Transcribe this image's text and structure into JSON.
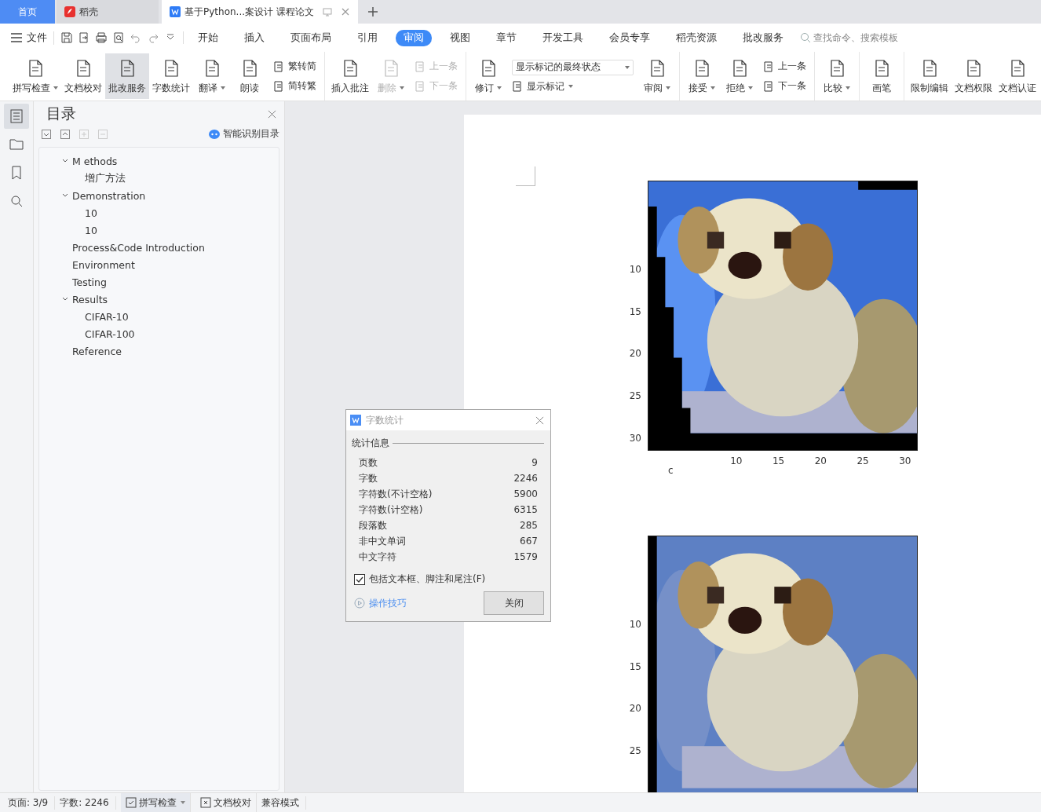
{
  "tabs": [
    {
      "kind": "home",
      "label": "首页",
      "selected": false
    },
    {
      "kind": "app",
      "label": "稻壳",
      "selected": false
    },
    {
      "kind": "doc",
      "label": "基于Python...案设计 课程论文",
      "selected": true
    }
  ],
  "menu": {
    "file": "文件",
    "ribbon_tabs": [
      {
        "label": "开始",
        "selected": false
      },
      {
        "label": "插入",
        "selected": false
      },
      {
        "label": "页面布局",
        "selected": false
      },
      {
        "label": "引用",
        "selected": false
      },
      {
        "label": "审阅",
        "selected": true
      },
      {
        "label": "视图",
        "selected": false
      },
      {
        "label": "章节",
        "selected": false
      },
      {
        "label": "开发工具",
        "selected": false
      },
      {
        "label": "会员专享",
        "selected": false
      },
      {
        "label": "稻壳资源",
        "selected": false
      },
      {
        "label": "批改服务",
        "selected": false
      }
    ],
    "search": {
      "placeholder": "查找命令、搜索模板"
    }
  },
  "ribbon": [
    [
      {
        "kind": "big",
        "label": "拼写检查",
        "dropdown": true,
        "disabled": false,
        "selected": false
      },
      {
        "kind": "big",
        "label": "文档校对",
        "dropdown": false,
        "disabled": false,
        "selected": false
      },
      {
        "kind": "big",
        "label": "批改服务",
        "dropdown": false,
        "disabled": false,
        "selected": true
      },
      {
        "kind": "big",
        "label": "字数统计",
        "dropdown": false,
        "disabled": false,
        "selected": false
      },
      {
        "kind": "big",
        "label": "翻译",
        "dropdown": true,
        "disabled": false,
        "selected": false
      },
      {
        "kind": "big",
        "label": "朗读",
        "dropdown": false,
        "disabled": false,
        "selected": false
      },
      {
        "kind": "stack",
        "items": [
          {
            "label": "繁转简",
            "disabled": false
          },
          {
            "label": "简转繁",
            "disabled": false
          }
        ]
      }
    ],
    [
      {
        "kind": "big",
        "label": "插入批注",
        "dropdown": false,
        "disabled": false,
        "selected": false
      },
      {
        "kind": "big",
        "label": "删除",
        "dropdown": true,
        "disabled": true,
        "selected": false
      },
      {
        "kind": "stack",
        "items": [
          {
            "label": "上一条",
            "disabled": true
          },
          {
            "label": "下一条",
            "disabled": true
          }
        ]
      }
    ],
    [
      {
        "kind": "big",
        "label": "修订",
        "dropdown": true,
        "disabled": false,
        "selected": false
      },
      {
        "kind": "combo",
        "value": "显示标记的最终状态",
        "label": "显示标记"
      },
      {
        "kind": "big",
        "label": "审阅",
        "dropdown": true,
        "disabled": false,
        "selected": false
      }
    ],
    [
      {
        "kind": "big",
        "label": "接受",
        "dropdown": true,
        "disabled": false,
        "selected": false
      },
      {
        "kind": "big",
        "label": "拒绝",
        "dropdown": true,
        "disabled": false,
        "selected": false
      },
      {
        "kind": "stack",
        "items": [
          {
            "label": "上一条",
            "disabled": false
          },
          {
            "label": "下一条",
            "disabled": false
          }
        ]
      }
    ],
    [
      {
        "kind": "big",
        "label": "比较",
        "dropdown": true,
        "disabled": false,
        "selected": false
      }
    ],
    [
      {
        "kind": "big",
        "label": "画笔",
        "dropdown": false,
        "disabled": false,
        "selected": false
      }
    ],
    [
      {
        "kind": "big",
        "label": "限制编辑",
        "dropdown": false,
        "disabled": false,
        "selected": false
      },
      {
        "kind": "big",
        "label": "文档权限",
        "dropdown": false,
        "disabled": false,
        "selected": false
      },
      {
        "kind": "big",
        "label": "文档认证",
        "dropdown": false,
        "disabled": false,
        "selected": false
      }
    ]
  ],
  "toc": {
    "title": "目录",
    "smart": "智能识别目录",
    "items": [
      {
        "label": "M ethods",
        "expanded": true,
        "children": [
          {
            "label": "增广方法"
          }
        ]
      },
      {
        "label": "Demonstration",
        "expanded": true,
        "children": [
          {
            "label": "10"
          },
          {
            "label": "10"
          }
        ]
      },
      {
        "label": "Process&Code Introduction"
      },
      {
        "label": "Environment"
      },
      {
        "label": "Testing"
      },
      {
        "label": "Results",
        "expanded": true,
        "children": [
          {
            "label": "CIFAR-10"
          },
          {
            "label": "CIFAR-100"
          }
        ]
      },
      {
        "label": "Reference"
      }
    ]
  },
  "figures": [
    {
      "kind": "picture",
      "yticks": [
        "10",
        "15",
        "20",
        "25",
        "30"
      ],
      "xticks": [
        "10",
        "15",
        "20",
        "25",
        "30"
      ],
      "x_note": "c"
    },
    {
      "kind": "picture",
      "yticks": [
        "10",
        "15",
        "20",
        "25"
      ]
    }
  ],
  "dialog": {
    "title": "字数统计",
    "section": "统计信息",
    "stats": [
      {
        "label": "页数",
        "value": "9"
      },
      {
        "label": "字数",
        "value": "2246"
      },
      {
        "label": "字符数(不计空格)",
        "value": "5900"
      },
      {
        "label": "字符数(计空格)",
        "value": "6315"
      },
      {
        "label": "段落数",
        "value": "285"
      },
      {
        "label": "非中文单词",
        "value": "667"
      },
      {
        "label": "中文字符",
        "value": "1579"
      }
    ],
    "checkbox": {
      "label": "包括文本框、脚注和尾注(F)",
      "checked": true
    },
    "tips": "操作技巧",
    "close": "关闭"
  },
  "status_bar": {
    "page": "页面: 3/9",
    "words": "字数: 2246",
    "spell": "拼写检查",
    "proof": "文档校对",
    "mode": "兼容模式"
  }
}
